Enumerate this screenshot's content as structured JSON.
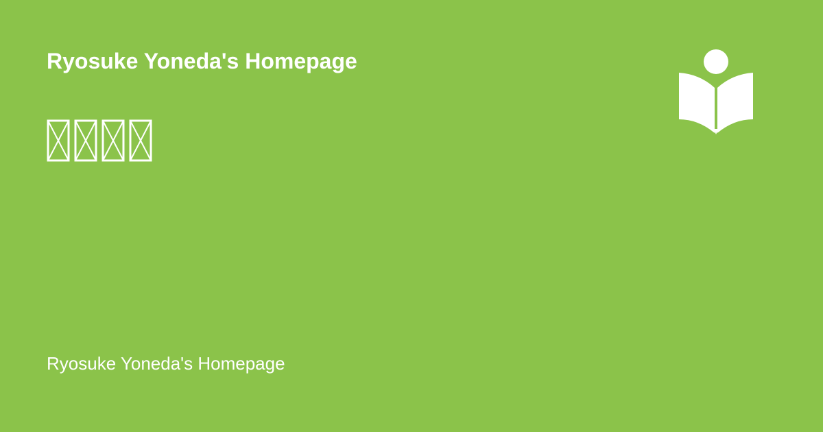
{
  "header": {
    "site_title": "Ryosuke Yoneda's Homepage"
  },
  "main": {
    "heading_glyph_count": 4
  },
  "footer": {
    "site_name": "Ryosuke Yoneda's Homepage"
  },
  "logo": {
    "icon": "reader-book-icon"
  },
  "colors": {
    "background": "#8bc34a",
    "foreground": "#ffffff"
  }
}
